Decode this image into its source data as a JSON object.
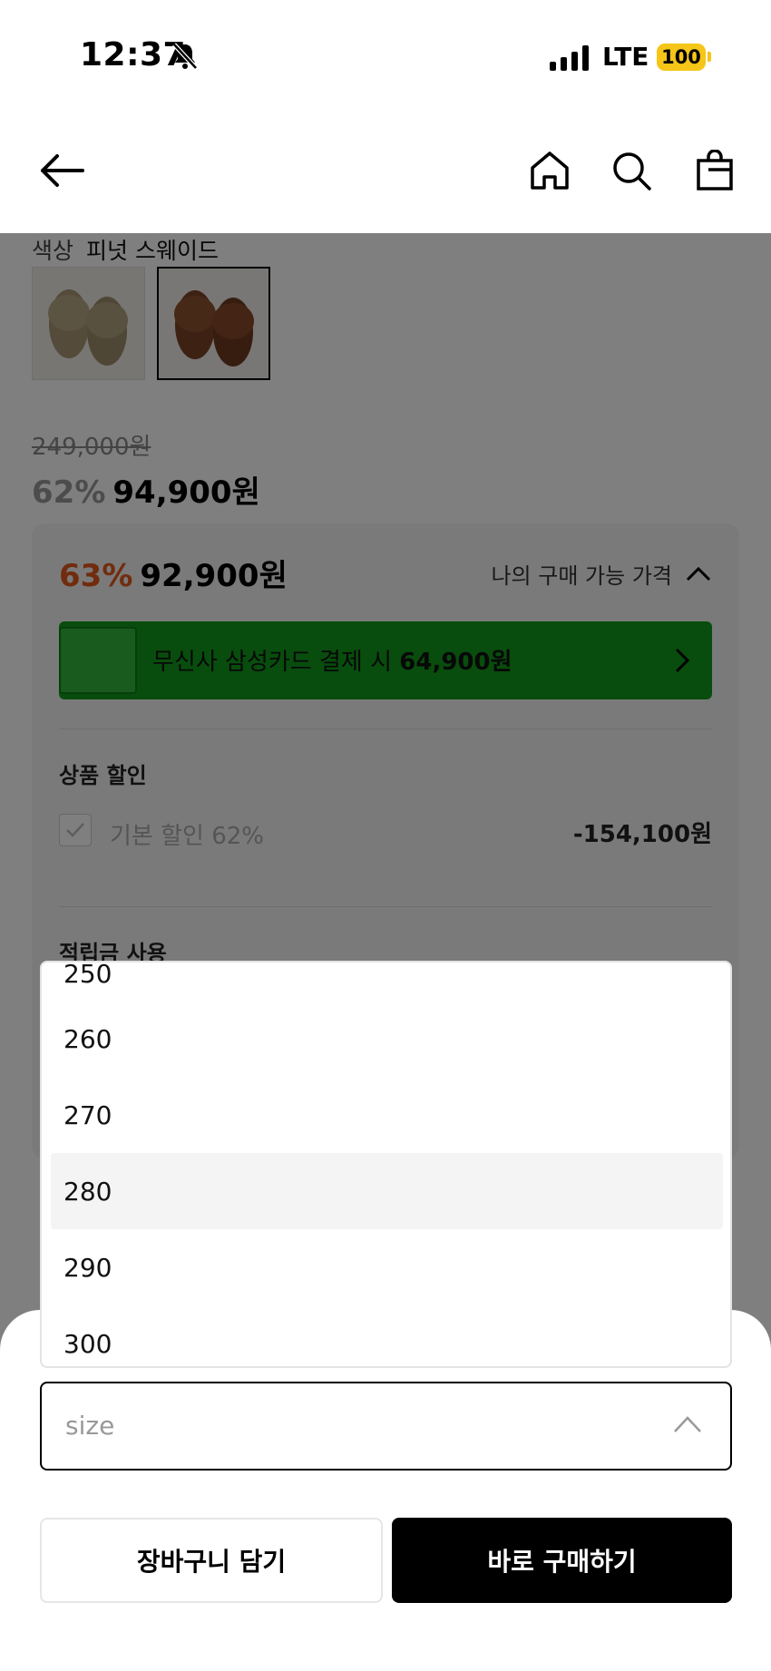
{
  "status_bar": {
    "time": "12:37",
    "network": "LTE",
    "battery": "100"
  },
  "header": {
    "icons": [
      "back-arrow-icon",
      "home-icon",
      "search-icon",
      "shopping-bag-icon"
    ]
  },
  "product": {
    "color_label": "색상",
    "color_value": "피넛 스웨이드",
    "thumbnails": [
      "sand suede slipper",
      "peanut suede slipper"
    ],
    "original_price": "249,000원",
    "sale_percent": "62%",
    "sale_price": "94,900원"
  },
  "price_box": {
    "my_percent": "63%",
    "my_price": "92,900원",
    "my_price_label": "나의 구매 가능 가격",
    "card_banner_prefix": "무신사 삼성카드 결제 시 ",
    "card_banner_price": "64,900원",
    "product_discount_title": "상품 할인",
    "basic_discount_label": "기본 할인 62%",
    "basic_discount_value": "-154,100원",
    "points_title": "적립금 사용"
  },
  "dropdown": {
    "options": [
      "250",
      "260",
      "270",
      "280",
      "290",
      "300"
    ],
    "highlighted": "280"
  },
  "size_select": {
    "placeholder": "size"
  },
  "buttons": {
    "add_to_cart": "장바구니 담기",
    "buy_now": "바로 구매하기"
  },
  "colors": {
    "overlay": "#000000",
    "sale_accent": "#e2591c",
    "card_banner": "#119b1b",
    "battery": "#f5c518"
  }
}
